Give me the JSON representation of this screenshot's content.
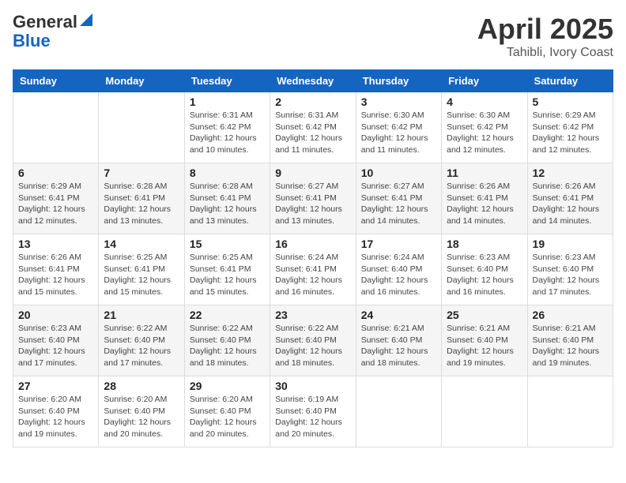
{
  "header": {
    "logo_line1": "General",
    "logo_line2": "Blue",
    "month_title": "April 2025",
    "location": "Tahibli, Ivory Coast"
  },
  "days_of_week": [
    "Sunday",
    "Monday",
    "Tuesday",
    "Wednesday",
    "Thursday",
    "Friday",
    "Saturday"
  ],
  "weeks": [
    [
      {
        "day": "",
        "info": ""
      },
      {
        "day": "",
        "info": ""
      },
      {
        "day": "1",
        "info": "Sunrise: 6:31 AM\nSunset: 6:42 PM\nDaylight: 12 hours and 10 minutes."
      },
      {
        "day": "2",
        "info": "Sunrise: 6:31 AM\nSunset: 6:42 PM\nDaylight: 12 hours and 11 minutes."
      },
      {
        "day": "3",
        "info": "Sunrise: 6:30 AM\nSunset: 6:42 PM\nDaylight: 12 hours and 11 minutes."
      },
      {
        "day": "4",
        "info": "Sunrise: 6:30 AM\nSunset: 6:42 PM\nDaylight: 12 hours and 12 minutes."
      },
      {
        "day": "5",
        "info": "Sunrise: 6:29 AM\nSunset: 6:42 PM\nDaylight: 12 hours and 12 minutes."
      }
    ],
    [
      {
        "day": "6",
        "info": "Sunrise: 6:29 AM\nSunset: 6:41 PM\nDaylight: 12 hours and 12 minutes."
      },
      {
        "day": "7",
        "info": "Sunrise: 6:28 AM\nSunset: 6:41 PM\nDaylight: 12 hours and 13 minutes."
      },
      {
        "day": "8",
        "info": "Sunrise: 6:28 AM\nSunset: 6:41 PM\nDaylight: 12 hours and 13 minutes."
      },
      {
        "day": "9",
        "info": "Sunrise: 6:27 AM\nSunset: 6:41 PM\nDaylight: 12 hours and 13 minutes."
      },
      {
        "day": "10",
        "info": "Sunrise: 6:27 AM\nSunset: 6:41 PM\nDaylight: 12 hours and 14 minutes."
      },
      {
        "day": "11",
        "info": "Sunrise: 6:26 AM\nSunset: 6:41 PM\nDaylight: 12 hours and 14 minutes."
      },
      {
        "day": "12",
        "info": "Sunrise: 6:26 AM\nSunset: 6:41 PM\nDaylight: 12 hours and 14 minutes."
      }
    ],
    [
      {
        "day": "13",
        "info": "Sunrise: 6:26 AM\nSunset: 6:41 PM\nDaylight: 12 hours and 15 minutes."
      },
      {
        "day": "14",
        "info": "Sunrise: 6:25 AM\nSunset: 6:41 PM\nDaylight: 12 hours and 15 minutes."
      },
      {
        "day": "15",
        "info": "Sunrise: 6:25 AM\nSunset: 6:41 PM\nDaylight: 12 hours and 15 minutes."
      },
      {
        "day": "16",
        "info": "Sunrise: 6:24 AM\nSunset: 6:41 PM\nDaylight: 12 hours and 16 minutes."
      },
      {
        "day": "17",
        "info": "Sunrise: 6:24 AM\nSunset: 6:40 PM\nDaylight: 12 hours and 16 minutes."
      },
      {
        "day": "18",
        "info": "Sunrise: 6:23 AM\nSunset: 6:40 PM\nDaylight: 12 hours and 16 minutes."
      },
      {
        "day": "19",
        "info": "Sunrise: 6:23 AM\nSunset: 6:40 PM\nDaylight: 12 hours and 17 minutes."
      }
    ],
    [
      {
        "day": "20",
        "info": "Sunrise: 6:23 AM\nSunset: 6:40 PM\nDaylight: 12 hours and 17 minutes."
      },
      {
        "day": "21",
        "info": "Sunrise: 6:22 AM\nSunset: 6:40 PM\nDaylight: 12 hours and 17 minutes."
      },
      {
        "day": "22",
        "info": "Sunrise: 6:22 AM\nSunset: 6:40 PM\nDaylight: 12 hours and 18 minutes."
      },
      {
        "day": "23",
        "info": "Sunrise: 6:22 AM\nSunset: 6:40 PM\nDaylight: 12 hours and 18 minutes."
      },
      {
        "day": "24",
        "info": "Sunrise: 6:21 AM\nSunset: 6:40 PM\nDaylight: 12 hours and 18 minutes."
      },
      {
        "day": "25",
        "info": "Sunrise: 6:21 AM\nSunset: 6:40 PM\nDaylight: 12 hours and 19 minutes."
      },
      {
        "day": "26",
        "info": "Sunrise: 6:21 AM\nSunset: 6:40 PM\nDaylight: 12 hours and 19 minutes."
      }
    ],
    [
      {
        "day": "27",
        "info": "Sunrise: 6:20 AM\nSunset: 6:40 PM\nDaylight: 12 hours and 19 minutes."
      },
      {
        "day": "28",
        "info": "Sunrise: 6:20 AM\nSunset: 6:40 PM\nDaylight: 12 hours and 20 minutes."
      },
      {
        "day": "29",
        "info": "Sunrise: 6:20 AM\nSunset: 6:40 PM\nDaylight: 12 hours and 20 minutes."
      },
      {
        "day": "30",
        "info": "Sunrise: 6:19 AM\nSunset: 6:40 PM\nDaylight: 12 hours and 20 minutes."
      },
      {
        "day": "",
        "info": ""
      },
      {
        "day": "",
        "info": ""
      },
      {
        "day": "",
        "info": ""
      }
    ]
  ]
}
